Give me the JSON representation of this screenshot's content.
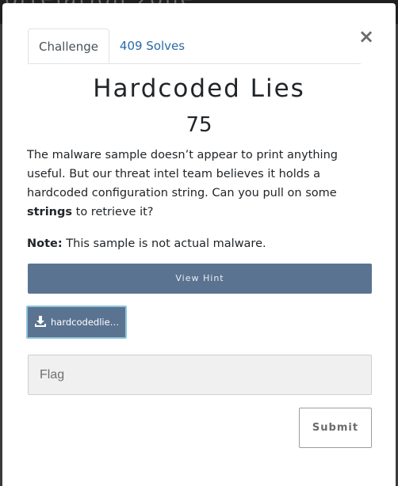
{
  "backdrop": {
    "title_fragment": "orrelation zone"
  },
  "modal": {
    "tabs": [
      {
        "label": "Challenge",
        "active": true
      },
      {
        "label": "409 Solves",
        "active": false
      }
    ],
    "close_symbol": "×",
    "challenge": {
      "name": "Hardcoded Lies",
      "points": "75",
      "description_before": "The malware sample doesn’t appear to print anything useful. But our threat intel team believes it holds a hardcoded configuration string. Can you pull on some ",
      "description_bold": "strings",
      "description_after": " to retrieve it?",
      "note_label": "Note:",
      "note_text": " This sample is not actual malware."
    },
    "hint_button_label": "View Hint",
    "file": {
      "name": "hardcodedlies.exe",
      "icon": "download-icon"
    },
    "flag_input": {
      "placeholder": "Flag",
      "value": ""
    },
    "submit_label": "Submit"
  },
  "colors": {
    "accent": "#5a7391",
    "link": "#2a6aa8",
    "file_border": "#8ec5da",
    "input_bg": "#f0f0f0"
  }
}
